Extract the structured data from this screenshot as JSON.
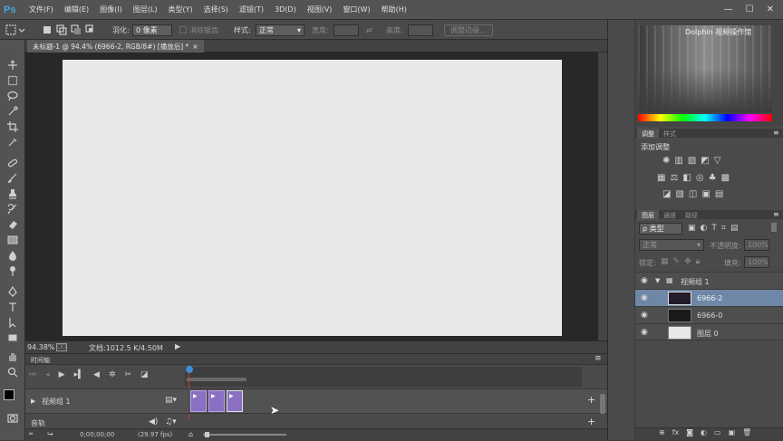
{
  "app": {
    "logo": "Ps"
  },
  "menu": [
    "文件(F)",
    "编辑(E)",
    "图像(I)",
    "图层(L)",
    "类型(Y)",
    "选择(S)",
    "滤镜(T)",
    "3D(D)",
    "视图(V)",
    "窗口(W)",
    "帮助(H)"
  ],
  "window_controls": {
    "minimize": "—",
    "restore": "☐",
    "close": "✕"
  },
  "options": {
    "feather_label": "羽化:",
    "feather_value": "0 像素",
    "antialias_label": "消除锯齿",
    "style_label": "样式:",
    "style_value": "正常",
    "width_label": "宽度:",
    "height_label": "高度:",
    "refine_button": "调整边缘..."
  },
  "document": {
    "tab_title": "未标题-1 @ 94.4% (6966-2, RGB/8#) [播放后] *",
    "close": "×",
    "zoom": "94.38%",
    "doc_info": "文档:1012.5 K/4.50M"
  },
  "timeline": {
    "panel_title": "时间轴",
    "track_name": "视频组 1",
    "audio_label": "音轨",
    "timecode": "0;00;00;00",
    "fps": "(29.97 fps)"
  },
  "color_panel": {
    "overlay_text": "Dolphin 视频操作馆"
  },
  "adjustments": {
    "tabs": [
      "调整",
      "样式"
    ],
    "add_label": "添加调整"
  },
  "layers_panel": {
    "tabs": [
      "图层",
      "通道",
      "路径"
    ],
    "filter_kind": "ρ 类型",
    "blend_mode": "正常",
    "opacity_label": "不透明度:",
    "opacity_value": "100%",
    "lock_label": "锁定:",
    "fill_label": "填充:",
    "fill_value": "100%",
    "layers": [
      {
        "name": "视频组 1",
        "type": "group"
      },
      {
        "name": "6966-2",
        "type": "video",
        "selected": true
      },
      {
        "name": "6966-0",
        "type": "video"
      },
      {
        "name": "图层 0",
        "type": "layer"
      }
    ]
  },
  "colors": {
    "accent_selected": "#6f87a6",
    "clip": "#8b6fc3",
    "playhead": "#3f8fd6"
  }
}
